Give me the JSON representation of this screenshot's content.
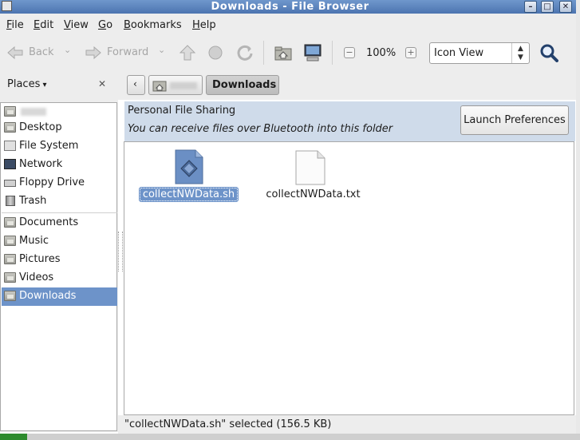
{
  "window": {
    "title": "Downloads - File Browser",
    "controls": [
      "minimize-icon",
      "maximize-icon",
      "close-icon"
    ]
  },
  "menubar": {
    "items": [
      {
        "label": "File",
        "mnemonic": "F",
        "rest": "ile"
      },
      {
        "label": "Edit",
        "mnemonic": "E",
        "rest": "dit"
      },
      {
        "label": "View",
        "mnemonic": "V",
        "rest": "iew"
      },
      {
        "label": "Go",
        "mnemonic": "G",
        "rest": "o"
      },
      {
        "label": "Bookmarks",
        "mnemonic": "B",
        "rest": "ookmarks"
      },
      {
        "label": "Help",
        "mnemonic": "H",
        "rest": "elp"
      }
    ]
  },
  "toolbar": {
    "back_label": "Back",
    "forward_label": "Forward",
    "zoom_level": "100%",
    "view_mode": "Icon View",
    "icons": [
      "back-arrow-icon",
      "forward-arrow-icon",
      "up-icon",
      "stop-icon",
      "reload-icon",
      "home-icon",
      "computer-icon",
      "zoom-out-icon",
      "zoom-in-icon",
      "search-icon"
    ]
  },
  "sidebar": {
    "header": "Places",
    "close_glyph": "✕",
    "items": [
      {
        "label": "",
        "icon": "home-folder-icon",
        "blurred": true
      },
      {
        "label": "Desktop",
        "icon": "desktop-folder-icon"
      },
      {
        "label": "File System",
        "icon": "filesystem-icon"
      },
      {
        "label": "Network",
        "icon": "network-icon"
      },
      {
        "label": "Floppy Drive",
        "icon": "floppy-icon"
      },
      {
        "label": "Trash",
        "icon": "trash-icon"
      },
      {
        "label": "Documents",
        "icon": "documents-folder-icon"
      },
      {
        "label": "Music",
        "icon": "music-folder-icon"
      },
      {
        "label": "Pictures",
        "icon": "pictures-folder-icon"
      },
      {
        "label": "Videos",
        "icon": "videos-folder-icon"
      },
      {
        "label": "Downloads",
        "icon": "downloads-folder-icon",
        "selected": true
      }
    ]
  },
  "pathbar": {
    "current": "Downloads"
  },
  "infobar": {
    "title": "Personal File Sharing",
    "message": "You can receive files over Bluetooth into this folder",
    "button_label": "Launch Preferences"
  },
  "files": [
    {
      "name": "collectNWData.sh",
      "icon": "script-file-icon",
      "selected": true
    },
    {
      "name": "collectNWData.txt",
      "icon": "text-file-icon",
      "selected": false
    }
  ],
  "status": {
    "text": "\"collectNWData.sh\" selected (156.5 KB)"
  },
  "colors": {
    "titlebar": "#5b82bc",
    "selection": "#6d93c9",
    "infobar": "#cfdbea"
  }
}
